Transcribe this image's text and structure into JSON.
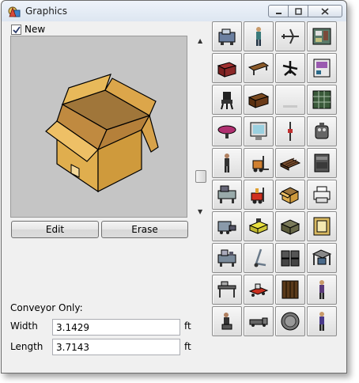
{
  "window": {
    "title": "Graphics"
  },
  "new_checkbox": {
    "label": "New",
    "checked": true
  },
  "preview": {
    "content": "open cardboard box"
  },
  "buttons": {
    "edit": "Edit",
    "erase": "Erase"
  },
  "conveyor": {
    "heading": "Conveyor Only:",
    "width_label": "Width",
    "width_value": "3.1429",
    "length_label": "Length",
    "length_value": "3.7143",
    "unit": "ft"
  },
  "graphics_palette": [
    {
      "name": "machine-icon"
    },
    {
      "name": "person-icon"
    },
    {
      "name": "airplane-icon"
    },
    {
      "name": "control-panel-icon"
    },
    {
      "name": "cabinet-icon"
    },
    {
      "name": "table-icon"
    },
    {
      "name": "chair-icon"
    },
    {
      "name": "monitor-panel-icon"
    },
    {
      "name": "office-chair-icon"
    },
    {
      "name": "desk-icon"
    },
    {
      "name": "blank-icon"
    },
    {
      "name": "storage-rack-icon"
    },
    {
      "name": "round-table-icon"
    },
    {
      "name": "computer-monitor-icon"
    },
    {
      "name": "pole-icon"
    },
    {
      "name": "robot-icon"
    },
    {
      "name": "worker-icon"
    },
    {
      "name": "forklift-icon"
    },
    {
      "name": "pallet-icon"
    },
    {
      "name": "cabinet-unit-icon"
    },
    {
      "name": "workstation-icon"
    },
    {
      "name": "red-forklift-icon"
    },
    {
      "name": "open-box-icon"
    },
    {
      "name": "printer-icon"
    },
    {
      "name": "conveyor-machine-icon"
    },
    {
      "name": "yellow-cart-icon"
    },
    {
      "name": "loaded-pallet-icon"
    },
    {
      "name": "framed-box-icon"
    },
    {
      "name": "assembly-machine-icon"
    },
    {
      "name": "hand-truck-icon"
    },
    {
      "name": "barrels-icon"
    },
    {
      "name": "work-cell-icon"
    },
    {
      "name": "bench-icon"
    },
    {
      "name": "red-cart-icon"
    },
    {
      "name": "crate-icon"
    },
    {
      "name": "operator-icon"
    },
    {
      "name": "seated-worker-icon"
    },
    {
      "name": "truck-icon"
    },
    {
      "name": "round-tank-icon"
    },
    {
      "name": "standing-worker-icon"
    }
  ]
}
